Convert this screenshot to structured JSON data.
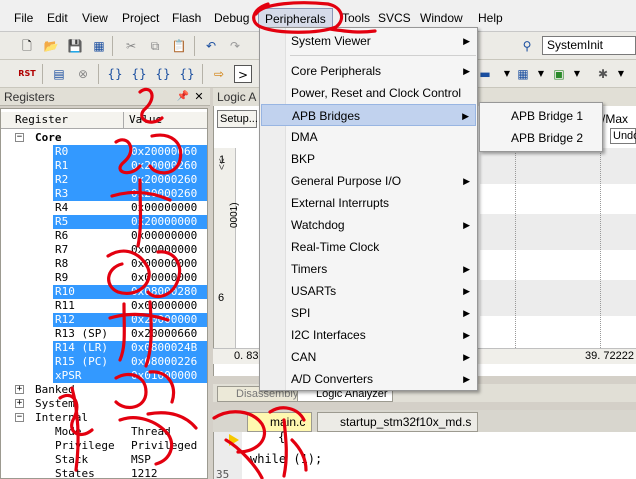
{
  "menubar": {
    "items": [
      "File",
      "Edit",
      "View",
      "Project",
      "Flash",
      "Debug",
      "Peripherals",
      "Tools",
      "SVCS",
      "Window",
      "Help"
    ],
    "active": "Peripherals"
  },
  "toolbar": {
    "target_select": "SystemInit",
    "rst_label": "RST"
  },
  "registers": {
    "title": "Registers",
    "col_register": "Register",
    "col_value": "Value",
    "rows": [
      {
        "name": "Core",
        "value": "",
        "group": true
      },
      {
        "name": "R0",
        "value": "0x20000060",
        "sel": true
      },
      {
        "name": "R1",
        "value": "0x20000260",
        "sel": true
      },
      {
        "name": "R2",
        "value": "0x20000260",
        "sel": true
      },
      {
        "name": "R3",
        "value": "0x20000260",
        "sel": true
      },
      {
        "name": "R4",
        "value": "0x00000000",
        "sel": false
      },
      {
        "name": "R5",
        "value": "0x20000000",
        "sel": true
      },
      {
        "name": "R6",
        "value": "0x00000000",
        "sel": false
      },
      {
        "name": "R7",
        "value": "0x00000000",
        "sel": false
      },
      {
        "name": "R8",
        "value": "0x00000000",
        "sel": false
      },
      {
        "name": "R9",
        "value": "0x00000000",
        "sel": false
      },
      {
        "name": "R10",
        "value": "0x08000280",
        "sel": true
      },
      {
        "name": "R11",
        "value": "0x00000000",
        "sel": false
      },
      {
        "name": "R12",
        "value": "0x20000000",
        "sel": true
      },
      {
        "name": "R13 (SP)",
        "value": "0x20000660",
        "sel": false
      },
      {
        "name": "R14 (LR)",
        "value": "0x0800024B",
        "sel": true
      },
      {
        "name": "R15 (PC)",
        "value": "0x08000226",
        "sel": true
      },
      {
        "name": "xPSR",
        "value": "0x01000000",
        "sel": true
      },
      {
        "name": "Banked",
        "value": "",
        "group": true
      },
      {
        "name": "System",
        "value": "",
        "group": true
      },
      {
        "name": "Internal",
        "value": "",
        "group": true
      },
      {
        "name": "Mode",
        "value": "Thread",
        "sel": false
      },
      {
        "name": "Privilege",
        "value": "Privileged",
        "sel": false
      },
      {
        "name": "Stack",
        "value": "MSP",
        "sel": false
      },
      {
        "name": "States",
        "value": "1212",
        "sel": false
      }
    ]
  },
  "logic": {
    "title": "Logic A",
    "setup": "Setup...",
    "max_label": "/Max",
    "undo": "Undo",
    "bottom_left": "0. 83",
    "bottom_right": "39. 72222",
    "side_label_1": "1",
    "side_label_2": "0001)",
    "side_label_3": "6"
  },
  "bottom_tabs": {
    "disassembly": "Disassembly",
    "logic_analyzer": "Logic Analyzer"
  },
  "file_tabs": {
    "main": "main.c",
    "startup": "startup_stm32f10x_md.s"
  },
  "code": {
    "line_no": "35",
    "text": "while (1);",
    "brace": "{"
  },
  "peripherals_menu": {
    "items": [
      {
        "label": "System Viewer",
        "arrow": true
      },
      {
        "label": "Core Peripherals",
        "arrow": true
      },
      {
        "label": "Power, Reset and Clock Control",
        "arrow": false
      },
      {
        "label": "APB Bridges",
        "arrow": true,
        "hl": true
      },
      {
        "label": "DMA",
        "arrow": false
      },
      {
        "label": "BKP",
        "arrow": false
      },
      {
        "label": "General Purpose I/O",
        "arrow": true
      },
      {
        "label": "External Interrupts",
        "arrow": false
      },
      {
        "label": "Watchdog",
        "arrow": true
      },
      {
        "label": "Real-Time Clock",
        "arrow": false
      },
      {
        "label": "Timers",
        "arrow": true
      },
      {
        "label": "USARTs",
        "arrow": true
      },
      {
        "label": "SPI",
        "arrow": true
      },
      {
        "label": "I2C Interfaces",
        "arrow": true
      },
      {
        "label": "CAN",
        "arrow": true
      },
      {
        "label": "A/D Converters",
        "arrow": true
      }
    ]
  },
  "apb_submenu": {
    "items": [
      "APB Bridge 1",
      "APB Bridge 2"
    ]
  },
  "colors": {
    "selection": "#3399ff",
    "annotation": "#e3000f",
    "menu_highlight": "#c1d2ee"
  }
}
